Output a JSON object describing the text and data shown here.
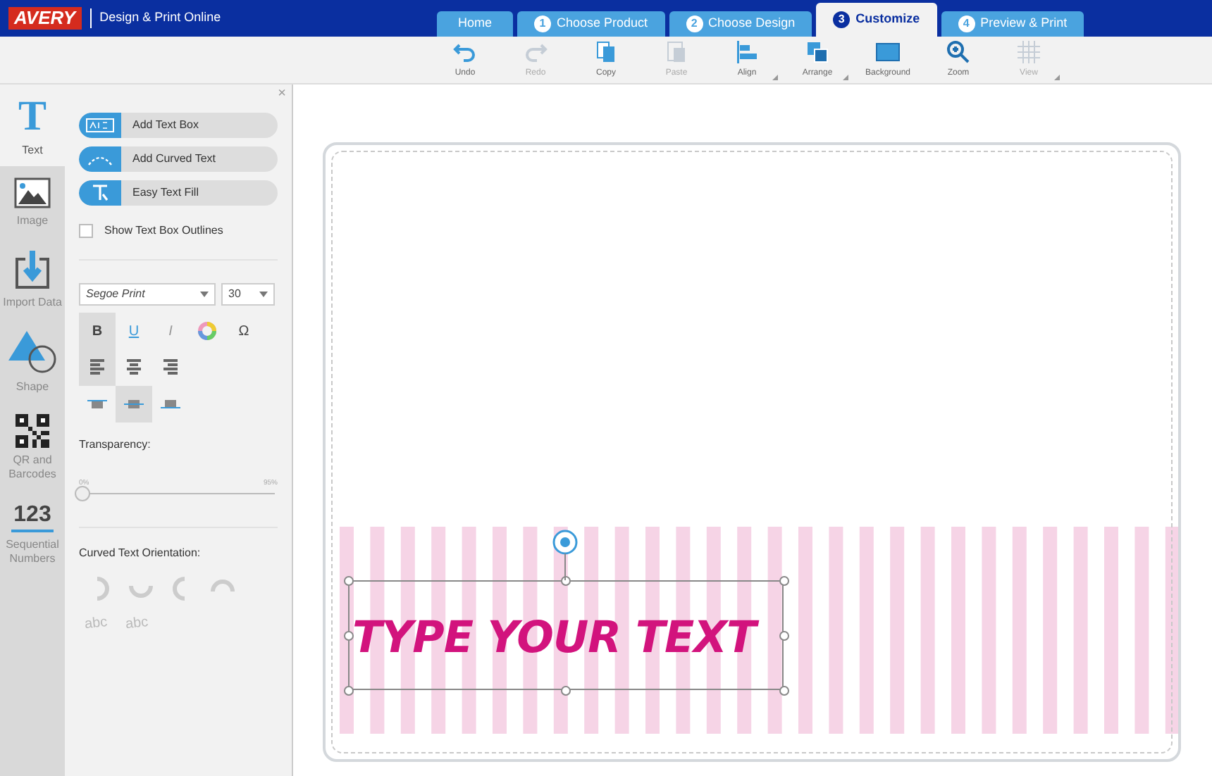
{
  "header": {
    "logo": "AVERY",
    "product": "Design & Print Online"
  },
  "tabs": [
    {
      "label": "Home",
      "selected": false
    },
    {
      "number": "1",
      "label": "Choose Product",
      "selected": false
    },
    {
      "number": "2",
      "label": "Choose Design",
      "selected": false
    },
    {
      "number": "3",
      "label": "Customize",
      "selected": true
    },
    {
      "number": "4",
      "label": "Preview & Print",
      "selected": false
    }
  ],
  "toolbar": [
    {
      "kind": "undo",
      "label": "Undo",
      "disabled": false,
      "dropdown": false
    },
    {
      "kind": "redo",
      "label": "Redo",
      "disabled": true,
      "dropdown": false
    },
    {
      "kind": "copy",
      "label": "Copy",
      "disabled": false,
      "dropdown": false
    },
    {
      "kind": "paste",
      "label": "Paste",
      "disabled": true,
      "dropdown": false
    },
    {
      "kind": "align",
      "label": "Align",
      "disabled": false,
      "dropdown": true
    },
    {
      "kind": "arrange",
      "label": "Arrange",
      "disabled": false,
      "dropdown": true
    },
    {
      "kind": "background",
      "label": "Background",
      "disabled": false,
      "dropdown": false
    },
    {
      "kind": "zoom",
      "label": "Zoom",
      "disabled": false,
      "dropdown": false
    },
    {
      "kind": "view",
      "label": "View",
      "disabled": true,
      "dropdown": true
    }
  ],
  "sidebar": {
    "items": [
      {
        "kind": "text",
        "icon_text": "T",
        "label": "Text",
        "selected": true
      },
      {
        "kind": "image",
        "label": "Image",
        "selected": false
      },
      {
        "kind": "import",
        "label": "Import Data",
        "selected": false
      },
      {
        "kind": "shape",
        "label": "Shape",
        "selected": false
      },
      {
        "kind": "qr",
        "label": "QR and Barcodes",
        "selected": false
      },
      {
        "kind": "numbers",
        "icon_text": "123",
        "label": "Sequential Numbers",
        "selected": false
      }
    ]
  },
  "panel": {
    "close": "×",
    "actions": [
      {
        "kind": "textbox",
        "label": "Add Text Box"
      },
      {
        "kind": "curved",
        "label": "Add Curved Text"
      },
      {
        "kind": "fill",
        "label": "Easy Text Fill"
      }
    ],
    "show_outlines": {
      "label": "Show Text Box Outlines",
      "checked": false
    },
    "font": "Segoe Print",
    "size": "30",
    "styles": [
      {
        "kind": "bold",
        "label": "B",
        "selected": true
      },
      {
        "kind": "underline",
        "label": "U",
        "selected": false
      },
      {
        "kind": "italic",
        "label": "I",
        "selected": false
      },
      {
        "kind": "color",
        "selected": false
      },
      {
        "kind": "symbol",
        "label": "Ω",
        "selected": false
      }
    ],
    "align": [
      {
        "kind": "left",
        "selected": true
      },
      {
        "kind": "center",
        "selected": false
      },
      {
        "kind": "right",
        "selected": false
      }
    ],
    "valign": [
      {
        "kind": "top",
        "selected": false
      },
      {
        "kind": "middle",
        "selected": true
      },
      {
        "kind": "bottom",
        "selected": false
      }
    ],
    "transparency": {
      "label": "Transparency:",
      "min": "0%",
      "max": "95%",
      "level": 0
    },
    "curved": {
      "label": "Curved Text Orientation:",
      "options": [
        {
          "kind": "right"
        },
        {
          "kind": "bottom"
        },
        {
          "kind": "left"
        },
        {
          "kind": "top"
        },
        {
          "kind": "text",
          "label": "abc"
        },
        {
          "kind": "text",
          "label": "abc"
        }
      ]
    }
  },
  "canvas": {
    "text": "TYPE YOUR TEXT"
  }
}
